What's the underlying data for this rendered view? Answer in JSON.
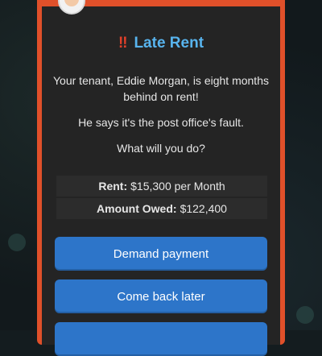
{
  "event": {
    "title": "Late Rent",
    "alert_icon": "‼",
    "message_lines": [
      "Your tenant, Eddie Morgan, is eight months behind on rent!",
      "He says it's the post office's fault.",
      "What will you do?"
    ],
    "rent_label": "Rent:",
    "rent_value": "$15,300 per Month",
    "owed_label": "Amount Owed:",
    "owed_value": "$122,400"
  },
  "buttons": {
    "demand": "Demand payment",
    "later": "Come back later",
    "third": ""
  },
  "colors": {
    "frame": "#e0502a",
    "card": "#242424",
    "title": "#58b4ee",
    "alert": "#e0402a",
    "button": "#2d75c9"
  }
}
